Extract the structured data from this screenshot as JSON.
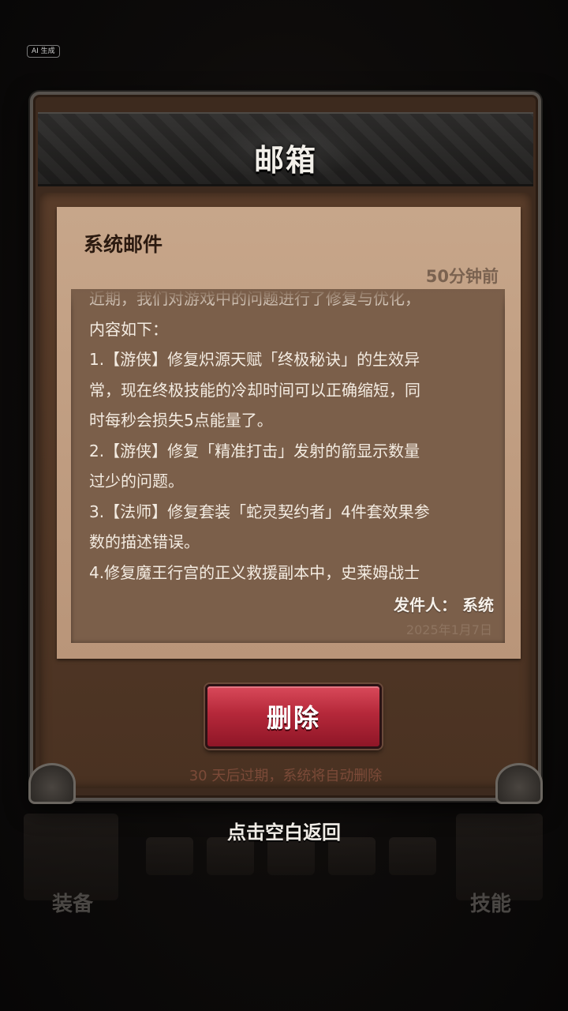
{
  "badge": {
    "ai_label": "AI 生成"
  },
  "dialog": {
    "title": "邮箱",
    "mail": {
      "title": "系统邮件",
      "time": "50分钟前",
      "body_lines": [
        "近期，我们对游戏中的问题进行了修复与优化，",
        "内容如下：",
        "1.【游侠】修复炽源天赋「终极秘诀」的生效异",
        "常，现在终极技能的冷却时间可以正确缩短，同",
        "时每秒会损失5点能量了。",
        "2.【游侠】修复「精准打击」发射的箭显示数量",
        "过少的问题。",
        "3.【法师】修复套装「蛇灵契约者」4件套效果参",
        "数的描述错误。",
        "4.修复魔王行宫的正义救援副本中，史莱姆战士"
      ],
      "sender": "发件人：  系统",
      "date": "2025年1月7日"
    },
    "delete_label": "删除",
    "expire_note": "30 天后过期，系统将自动删除"
  },
  "back_hint": "点击空白返回",
  "background": {
    "left_label": "装备",
    "right_label": "技能"
  }
}
